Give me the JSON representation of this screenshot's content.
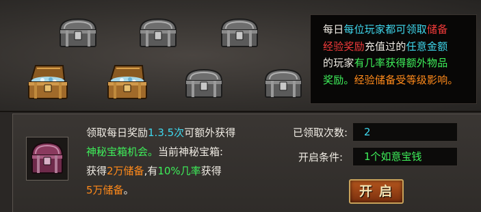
{
  "info": {
    "l1_a": "每日",
    "l1_b": "每位玩家都可领取",
    "l1_c": "储备",
    "l2_a": "经验奖励",
    "l2_b": "充值过的",
    "l2_c": "任意金额",
    "l3_a": "的玩家",
    "l3_b": "有几率获得额外物品",
    "l4_a": "奖励。",
    "l4_b": "经验储备受等级影响。"
  },
  "desc": {
    "d1": "领取每日奖励",
    "d2": "1.3.5次",
    "d3": "可额外获得",
    "d4": "神秘宝箱机会。",
    "d5": "当前神秘宝箱:",
    "d6": "获得",
    "d7": "2万储备",
    "d8": ",有",
    "d9": "10%几率",
    "d10": "获得",
    "d11": "5万储备",
    "d12": "。"
  },
  "claimed": {
    "label": "已领取次数:",
    "value": "2"
  },
  "condition": {
    "label": "开启条件:",
    "value": "1个如意宝钱"
  },
  "button": {
    "label": "开启"
  },
  "chests": [
    {
      "icon": "iron-chest-closed-icon"
    },
    {
      "icon": "iron-chest-closed-icon"
    },
    {
      "icon": "iron-chest-closed-icon"
    },
    {
      "icon": "wooden-chest-open-icon"
    },
    {
      "icon": "wooden-chest-open-icon"
    },
    {
      "icon": "iron-chest-closed-icon"
    },
    {
      "icon": "iron-chest-closed-icon"
    }
  ],
  "colors": {
    "highlight_cyan": "#3fd8ee",
    "highlight_red": "#f23a3a",
    "highlight_green": "#3ef05a",
    "highlight_orange": "#ff8a1a"
  }
}
